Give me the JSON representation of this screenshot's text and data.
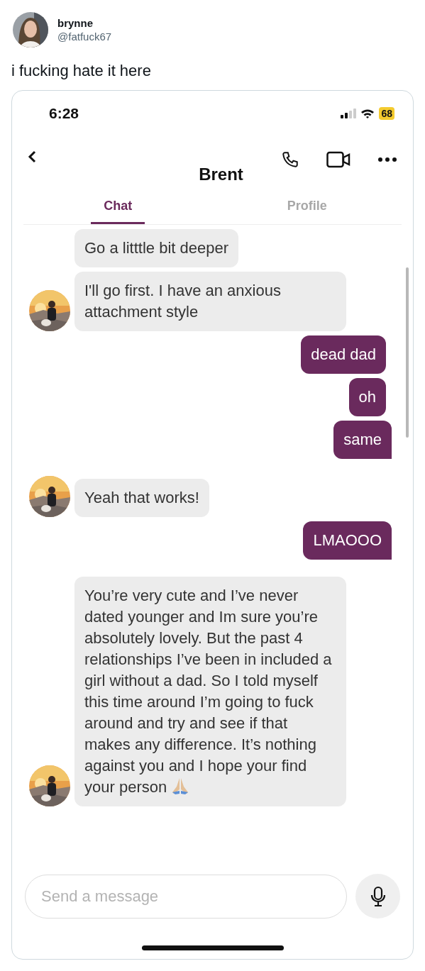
{
  "tweet": {
    "author": {
      "name": "brynne",
      "handle": "@fatfuck67"
    },
    "text": "i fucking hate it here"
  },
  "phone": {
    "status_bar": {
      "time": "6:28",
      "battery": "68"
    },
    "header": {
      "title": "Brent"
    },
    "tabs": [
      {
        "label": "Chat",
        "selected": true
      },
      {
        "label": "Profile",
        "selected": false
      }
    ],
    "messages": [
      {
        "kind": "received",
        "avatar": false,
        "tail": false,
        "trailing_icon": false,
        "text": "Go a litttle bit deeper"
      },
      {
        "kind": "received",
        "avatar": true,
        "tail": false,
        "trailing_icon": false,
        "text": "I'll go first. I have an anxious attachment style"
      },
      {
        "kind": "sent",
        "tail": false,
        "trailing_icon": false,
        "text": "dead dad"
      },
      {
        "kind": "sent",
        "tail": false,
        "trailing_icon": false,
        "text": "oh"
      },
      {
        "kind": "sent",
        "tail": true,
        "trailing_icon": false,
        "text": "same"
      },
      {
        "kind": "received",
        "avatar": true,
        "tail": false,
        "trailing_icon": false,
        "text": "Yeah that works!"
      },
      {
        "kind": "sent",
        "tail": true,
        "trailing_icon": false,
        "text": "LMAOOO"
      },
      {
        "kind": "received",
        "avatar": true,
        "tail": false,
        "trailing_icon": true,
        "text": "You’re very cute and I’ve never dated younger and Im sure you’re absolutely lovely. But the past 4 relationships I’ve been in included a girl without a dad. So I told myself this time around I’m going to fuck around and try and see if that makes any difference. It’s nothing against you and I hope your find your person"
      }
    ],
    "composer": {
      "placeholder": "Send a message"
    }
  }
}
